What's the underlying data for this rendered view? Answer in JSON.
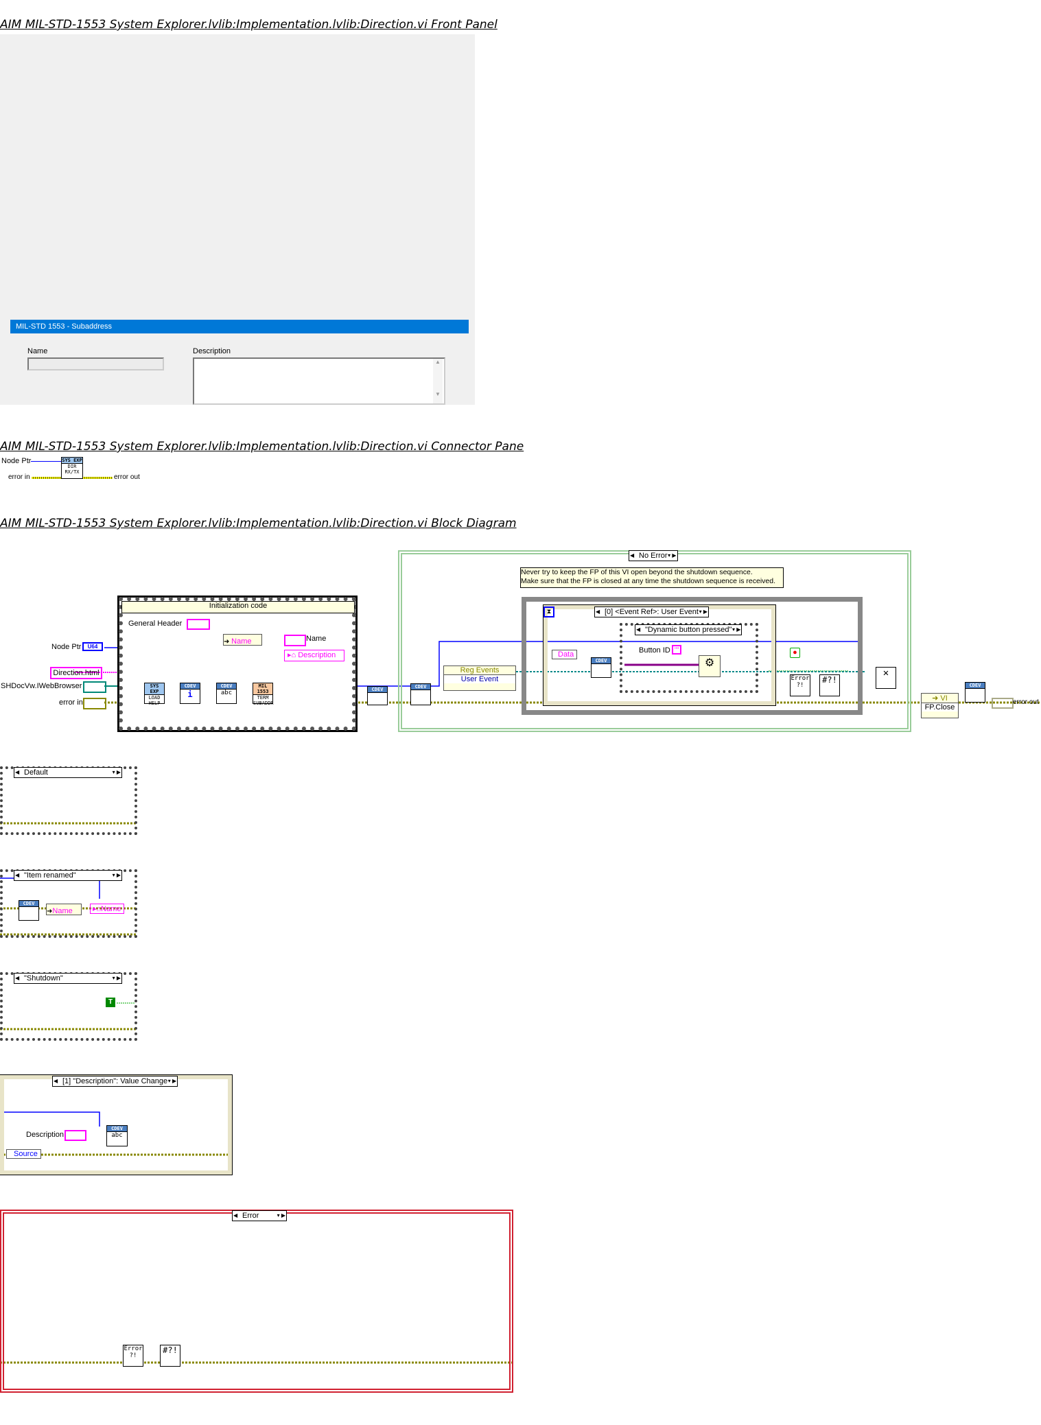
{
  "front_panel": {
    "title": "AIM MIL-STD-1553 System Explorer.lvlib:Implementation.lvlib:Direction.vi Front Panel",
    "header_bar": "MIL-STD 1553 - Subaddress",
    "name_label": "Name",
    "name_value": "",
    "description_label": "Description",
    "description_value": ""
  },
  "connector_pane": {
    "title": "AIM MIL-STD-1553 System Explorer.lvlib:Implementation.lvlib:Direction.vi Connector Pane",
    "inputs": [
      "Node Ptr",
      "error in"
    ],
    "outputs": [
      "error out"
    ],
    "icon_top": "SYS EXP",
    "icon_lines": [
      "DIR",
      "RX/TX"
    ]
  },
  "block_diagram": {
    "title": "AIM MIL-STD-1553 System Explorer.lvlib:Implementation.lvlib:Direction.vi Block Diagram",
    "init": {
      "frame_label": "Initialization code",
      "general_header": "General Header",
      "node_ptr": "Node Ptr",
      "node_ptr_type": "U64",
      "direction_html": "Direction.html",
      "webbrowser": "SHDocVw.IWebBrowser",
      "error_in": "error in",
      "name_unbundle": "Name",
      "name_indicator": "Name",
      "description_prop": "Description",
      "nodes": [
        {
          "top": "SYS EXP",
          "text": "LOAD HELP"
        },
        {
          "top": "CDEV",
          "text": "i"
        },
        {
          "top": "CDEV",
          "text": "abc"
        },
        {
          "top": "MIL 1553",
          "text": "TERM SUBADDR"
        }
      ]
    },
    "no_error_case": {
      "selector": "No Error",
      "comment": [
        "Never try to keep the FP of this VI open beyond the shutdown sequence.",
        "Make sure that the FP is closed at any time the shutdown sequence is received."
      ],
      "reg_events": "Reg Events",
      "user_event": "User Event",
      "event_selector": "[0] <Event Ref>: User Event",
      "data_label": "Data",
      "inner_case": "\"Dynamic button pressed\"",
      "button_id": "Button ID",
      "button_id_const": "\"\""
    },
    "fp_close": "FP.Close",
    "error_out": "error out",
    "cases": [
      {
        "selector": "Default"
      },
      {
        "selector": "\"Item renamed\"",
        "unbundle": "Name",
        "property": "Name"
      },
      {
        "selector": "\"Shutdown\"",
        "bool_const": "T"
      }
    ],
    "event_case": {
      "selector": "[1] \"Description\": Value Change",
      "description": "Description",
      "source": "Source"
    },
    "error_case": {
      "selector": "Error"
    }
  },
  "colors": {
    "header_blue": "#0078d7",
    "wire_blue": "#0000ff",
    "wire_pink": "#ff00ff",
    "error_wire": "#808000",
    "case_green": "#2e9e2e",
    "error_red": "#d02030"
  }
}
